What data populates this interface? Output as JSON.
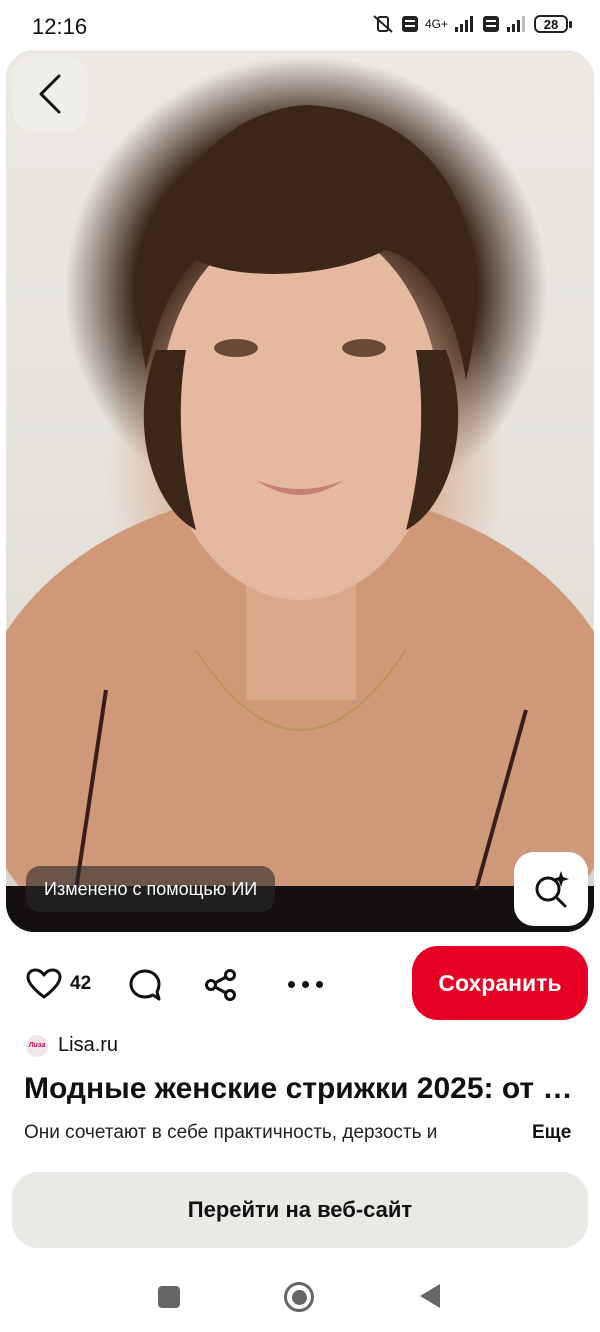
{
  "status_bar": {
    "time": "12:16",
    "network_label": "4G+",
    "battery": "28"
  },
  "pin": {
    "image_alt": "Portrait photo of a woman with a short layered pixie haircut",
    "ai_badge": "Изменено с помощью ИИ",
    "likes": "42",
    "save_label": "Сохранить",
    "source_name": "Lisa.ru",
    "source_avatar_text": "Лиза",
    "title": "Модные женские стрижки 2025: от …",
    "description": "Они сочетают в себе практичность, дерзость и",
    "more_label": "Еще",
    "visit_label": "Перейти на веб-сайт"
  },
  "icons": {
    "back": "chevron-left-icon",
    "lens": "visual-search-icon",
    "like": "heart-icon",
    "comment": "comment-icon",
    "share": "share-icon",
    "more": "more-icon"
  },
  "colors": {
    "save_button": "#e60023",
    "visit_button": "#e9e9e6"
  }
}
